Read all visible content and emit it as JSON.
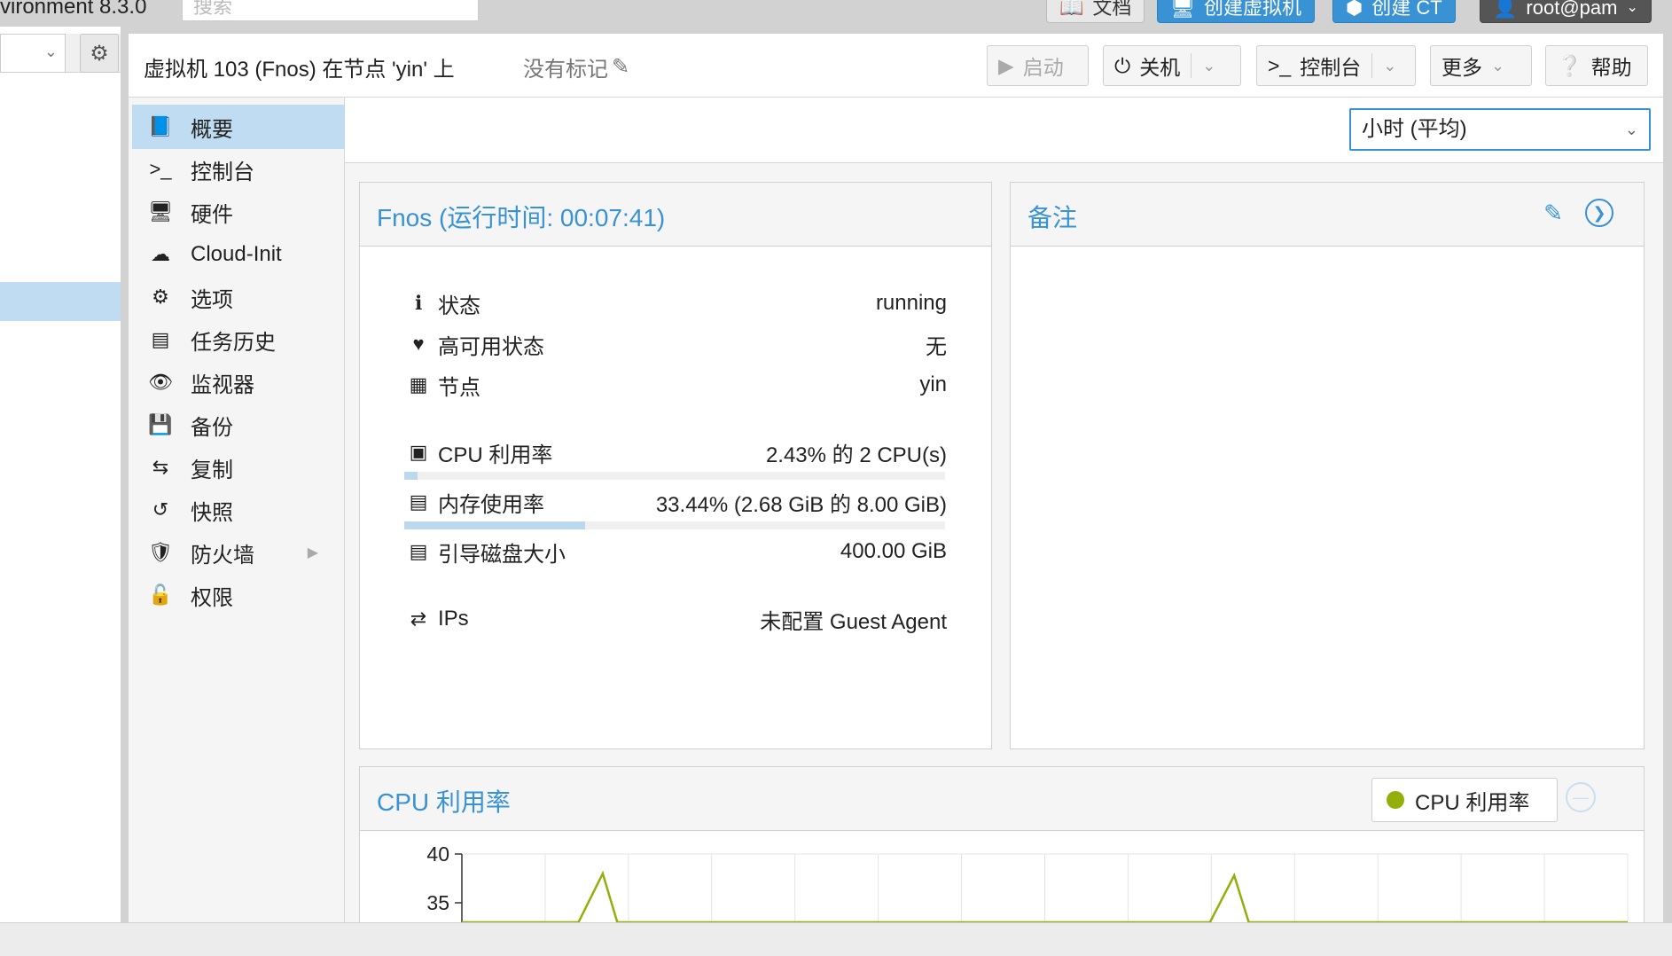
{
  "topbar": {
    "brand": "vironment 8.3.0",
    "search_placeholder": "搜索",
    "docs_label": "文档",
    "create_vm_label": "创建虚拟机",
    "create_ct_label": "创建 CT",
    "user_label": "root@pam"
  },
  "header": {
    "title": "虚拟机 103 (Fnos) 在节点 'yin' 上",
    "tags_label": "没有标记",
    "buttons": {
      "start": "启动",
      "shutdown": "关机",
      "console": "控制台",
      "more": "更多",
      "help": "帮助"
    }
  },
  "menu": {
    "items": [
      {
        "label": "概要",
        "icon": "book-icon",
        "active": true
      },
      {
        "label": "控制台",
        "icon": "terminal-icon"
      },
      {
        "label": "硬件",
        "icon": "desktop-icon"
      },
      {
        "label": "Cloud-Init",
        "icon": "cloud-icon"
      },
      {
        "label": "选项",
        "icon": "gear-icon"
      },
      {
        "label": "任务历史",
        "icon": "list-icon"
      },
      {
        "label": "监视器",
        "icon": "eye-icon"
      },
      {
        "label": "备份",
        "icon": "floppy-icon"
      },
      {
        "label": "复制",
        "icon": "retweet-icon"
      },
      {
        "label": "快照",
        "icon": "history-icon"
      },
      {
        "label": "防火墙",
        "icon": "shield-icon"
      },
      {
        "label": "权限",
        "icon": "unlock-icon"
      }
    ]
  },
  "summary": {
    "timeframe": "小时 (平均)",
    "status_panel_title": "Fnos (运行时间: 00:07:41)",
    "rows": {
      "status": {
        "label": "状态",
        "value": "running"
      },
      "ha": {
        "label": "高可用状态",
        "value": "无"
      },
      "node": {
        "label": "节点",
        "value": "yin"
      },
      "cpu": {
        "label": "CPU 利用率",
        "value": "2.43% 的 2 CPU(s)",
        "fraction": 0.0243
      },
      "memory": {
        "label": "内存使用率",
        "value": "33.44% (2.68 GiB 的 8.00 GiB)",
        "fraction": 0.3344
      },
      "disk": {
        "label": "引导磁盘大小",
        "value": "400.00 GiB"
      },
      "ips": {
        "label": "IPs",
        "value": "未配置 Guest Agent"
      }
    },
    "notes_title": "备注",
    "cpu_chart_title": "CPU 利用率",
    "legend_label": "CPU 利用率"
  },
  "colors": {
    "accent": "#3892d4",
    "selected": "#c0dcf2",
    "series": "#94ae0a"
  },
  "chart_data": {
    "type": "line",
    "title": "CPU 利用率",
    "ylabel": "",
    "xlabel": "",
    "y_ticks_visible": [
      40,
      35
    ],
    "ylim": [
      33,
      40
    ],
    "series": [
      {
        "name": "CPU 利用率",
        "x": [
          0,
          1.2,
          1.45,
          1.6,
          3.0,
          7.0,
          7.7,
          7.95,
          8.1,
          12
        ],
        "values": [
          33,
          33,
          38,
          33,
          33,
          33,
          33,
          37.8,
          33,
          33
        ]
      }
    ]
  }
}
